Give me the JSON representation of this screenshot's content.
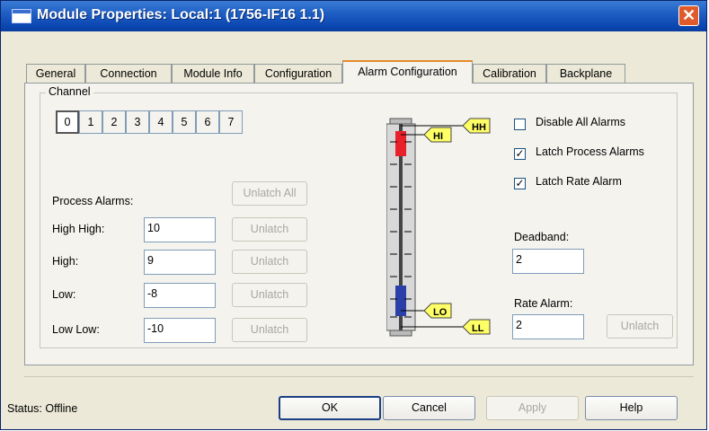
{
  "window": {
    "title": "Module Properties: Local:1 (1756-IF16 1.1)",
    "close_label": "✕"
  },
  "tabs": [
    "General",
    "Connection",
    "Module Info",
    "Configuration",
    "Alarm Configuration",
    "Calibration",
    "Backplane"
  ],
  "active_tab": "Alarm Configuration",
  "channel": {
    "label": "Channel",
    "buttons": [
      "0",
      "1",
      "2",
      "3",
      "4",
      "5",
      "6",
      "7"
    ],
    "selected": "0"
  },
  "process_alarms": {
    "label": "Process Alarms:",
    "unlatch_all": "Unlatch All",
    "rows": [
      {
        "label": "High High:",
        "value": "10",
        "button": "Unlatch"
      },
      {
        "label": "High:",
        "value": "9",
        "button": "Unlatch"
      },
      {
        "label": "Low:",
        "value": "-8",
        "button": "Unlatch"
      },
      {
        "label": "Low Low:",
        "value": "-10",
        "button": "Unlatch"
      }
    ]
  },
  "meter": {
    "markers": {
      "hh": "HH",
      "hi": "HI",
      "lo": "LO",
      "ll": "LL"
    },
    "colors": {
      "high": "#e8202a",
      "low": "#2a40a8",
      "marker": "#ffff66"
    }
  },
  "options": {
    "disable_all": {
      "label": "Disable All Alarms",
      "checked": false
    },
    "latch_process": {
      "label": "Latch Process Alarms",
      "checked": true
    },
    "latch_rate": {
      "label": "Latch Rate Alarm",
      "checked": true
    }
  },
  "deadband": {
    "label": "Deadband:",
    "value": "2"
  },
  "rate_alarm": {
    "label": "Rate Alarm:",
    "value": "2",
    "button": "Unlatch"
  },
  "footer": {
    "status": "Status:  Offline",
    "ok": "OK",
    "cancel": "Cancel",
    "apply": "Apply",
    "help": "Help"
  }
}
